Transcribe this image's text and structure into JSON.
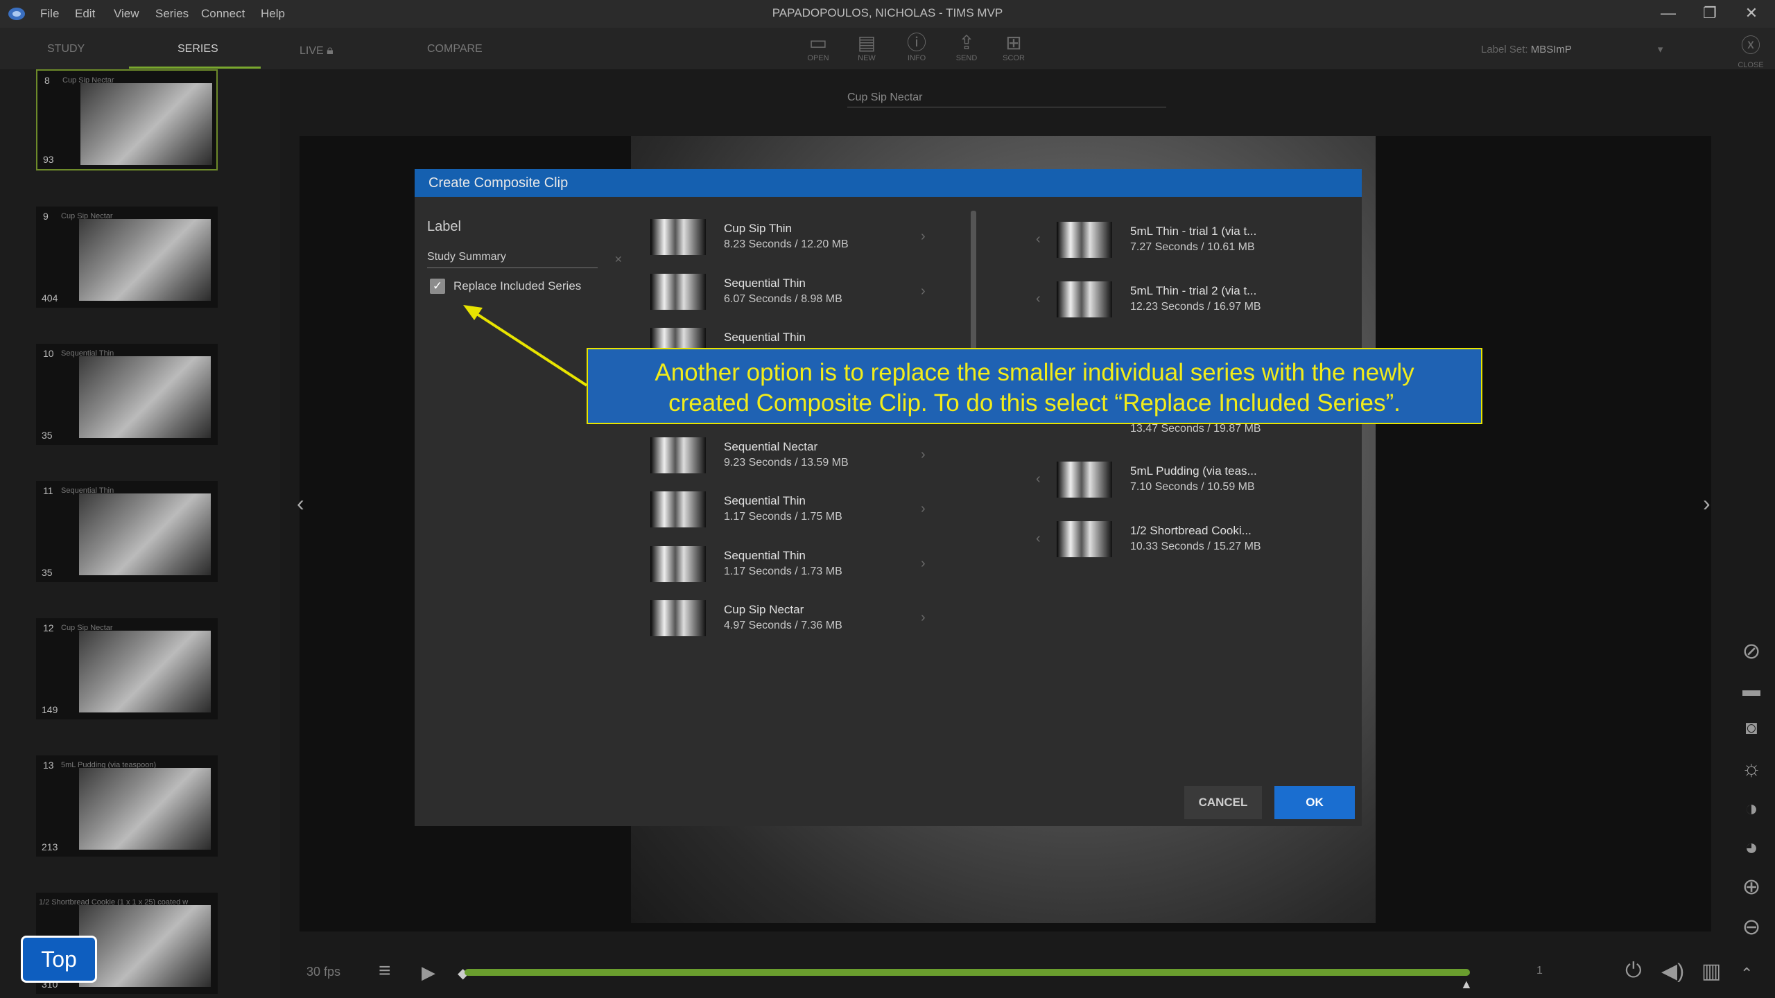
{
  "menu": [
    "File",
    "Edit",
    "View",
    "Series",
    "Connect",
    "Help"
  ],
  "window_title": "PAPADOPOULOS, NICHOLAS - TIMS MVP",
  "window_controls": {
    "minimize": "—",
    "restore": "❐",
    "close": "✕"
  },
  "tabs": {
    "study": "STUDY",
    "series": "SERIES",
    "live": "LIVE",
    "compare": "COMPARE"
  },
  "tools": [
    {
      "label": "OPEN",
      "icon": "folder-icon",
      "glyph": "▭"
    },
    {
      "label": "NEW",
      "icon": "new-icon",
      "glyph": "▤"
    },
    {
      "label": "INFO",
      "icon": "info-icon",
      "glyph": "ⓘ"
    },
    {
      "label": "SEND",
      "icon": "send-icon",
      "glyph": "⇪"
    },
    {
      "label": "SCOR",
      "icon": "score-icon",
      "glyph": "⊞"
    }
  ],
  "label_set": {
    "prefix": "Label Set:",
    "value": "MBSImP"
  },
  "close_label": "CLOSE",
  "thumbnails": [
    {
      "num": "8",
      "title": "Cup Sip Nectar",
      "frames": "93"
    },
    {
      "num": "9",
      "title": "Cup Sip Nectar",
      "frames": "404"
    },
    {
      "num": "10",
      "title": "Sequential Thin",
      "frames": "35"
    },
    {
      "num": "11",
      "title": "Sequential Thin",
      "frames": "35"
    },
    {
      "num": "12",
      "title": "Cup Sip Nectar",
      "frames": "149"
    },
    {
      "num": "13",
      "title": "5mL Pudding (via teaspoon)",
      "frames": "213"
    },
    {
      "num": "",
      "title": "1/2 Shortbread Cookie (1 x 1 x 25) coated w",
      "frames": "310"
    }
  ],
  "viewer_label": "Cup Sip Nectar",
  "dialog": {
    "title": "Create Composite Clip",
    "label_heading": "Label",
    "label_value": "Study Summary",
    "replace_checked": true,
    "replace_label": "Replace Included Series",
    "cancel": "CANCEL",
    "ok": "OK",
    "available": [
      {
        "name": "Cup Sip Thin",
        "meta": "8.23 Seconds / 12.20 MB"
      },
      {
        "name": "Sequential Thin",
        "meta": "6.07 Seconds / 8.98 MB"
      },
      {
        "name": "Sequential Thin",
        "meta": ""
      },
      {
        "name": "Sequential Nectar",
        "meta": "9.23 Seconds / 13.59 MB"
      },
      {
        "name": "Sequential Thin",
        "meta": "1.17 Seconds / 1.75 MB"
      },
      {
        "name": "Sequential Thin",
        "meta": "1.17 Seconds / 1.73 MB"
      },
      {
        "name": "Cup Sip Nectar",
        "meta": "4.97 Seconds / 7.36 MB"
      }
    ],
    "included": [
      {
        "name": "5mL Thin - trial 1 (via t...",
        "meta": "7.27 Seconds / 10.61 MB"
      },
      {
        "name": "5mL Thin - trial 2 (via t...",
        "meta": "12.23 Seconds / 16.97 MB"
      },
      {
        "name": "",
        "meta": "13.47 Seconds / 19.87 MB"
      },
      {
        "name": "5mL Pudding (via teas...",
        "meta": "7.10 Seconds / 10.59 MB"
      },
      {
        "name": "1/2 Shortbread Cooki...",
        "meta": "10.33 Seconds / 15.27 MB"
      }
    ]
  },
  "callout": {
    "line1": "Another option is to replace the smaller individual series with the newly",
    "line2": "created Composite Clip. To do this select “Replace Included Series”."
  },
  "player": {
    "fps": "30 fps",
    "frame_index": "1"
  },
  "top_button": "Top",
  "colors": {
    "accent": "#1560b0",
    "timeline": "#6a9e2e",
    "callout_text": "#f2ec1a"
  }
}
